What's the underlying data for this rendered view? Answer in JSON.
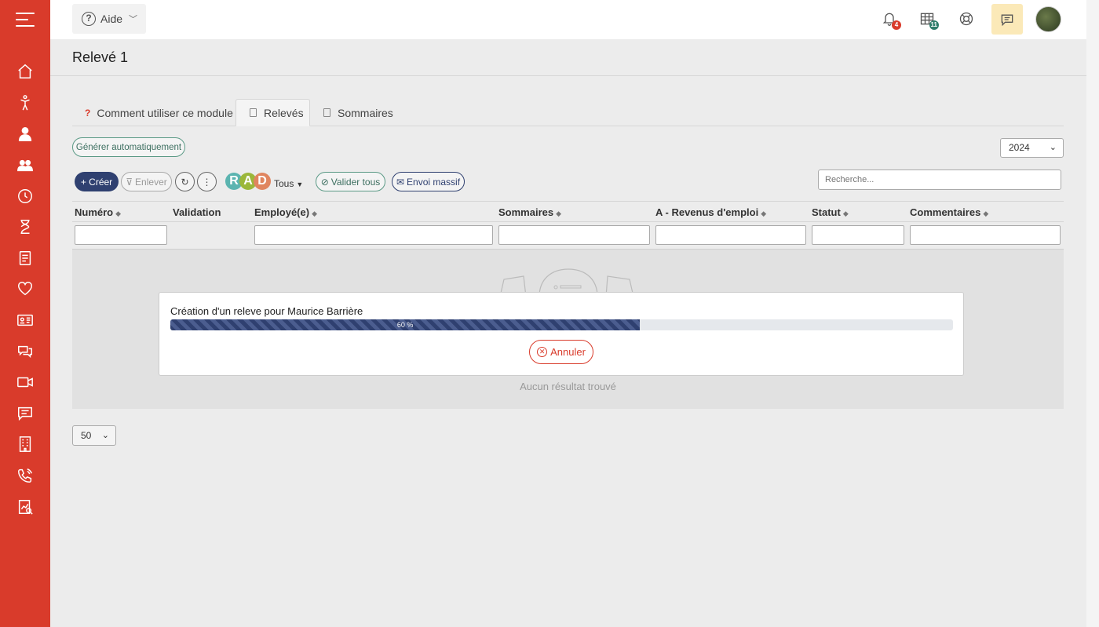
{
  "topbar": {
    "help_label": "Aide",
    "notif_count": "4",
    "calendar_count": "11"
  },
  "page": {
    "title": "Relevé 1"
  },
  "tabs": [
    {
      "label": "Comment utiliser ce module"
    },
    {
      "label": "Relevés"
    },
    {
      "label": "Sommaires"
    }
  ],
  "toolbar": {
    "generate_label": "Générer automatiquement",
    "year": "2024",
    "create_label": "+ Créer",
    "remove_label": "Enlever",
    "rad_letters": [
      "R",
      "A",
      "D"
    ],
    "status_filter": "Tous",
    "validate_all_label": "Valider tous",
    "mass_send_label": "Envoi massif",
    "search_placeholder": "Recherche..."
  },
  "table": {
    "columns": [
      "Numéro",
      "Validation",
      "Employé(e)",
      "Sommaires",
      "A - Revenus d'emploi",
      "Statut",
      "Commentaires"
    ],
    "empty_text": "Aucun résultat trouvé"
  },
  "modal": {
    "title": "Création d'un releve pour Maurice Barrière",
    "progress_percent": 60,
    "progress_label": "60 %",
    "cancel_label": "Annuler"
  },
  "pagination": {
    "page_size": "50"
  },
  "colors": {
    "sidebar": "#d93b2b",
    "primary": "#2f4070",
    "success": "#5b9a86",
    "rad_r": "#5bb4b0",
    "rad_a": "#9bb73a",
    "rad_d": "#e0855f"
  }
}
